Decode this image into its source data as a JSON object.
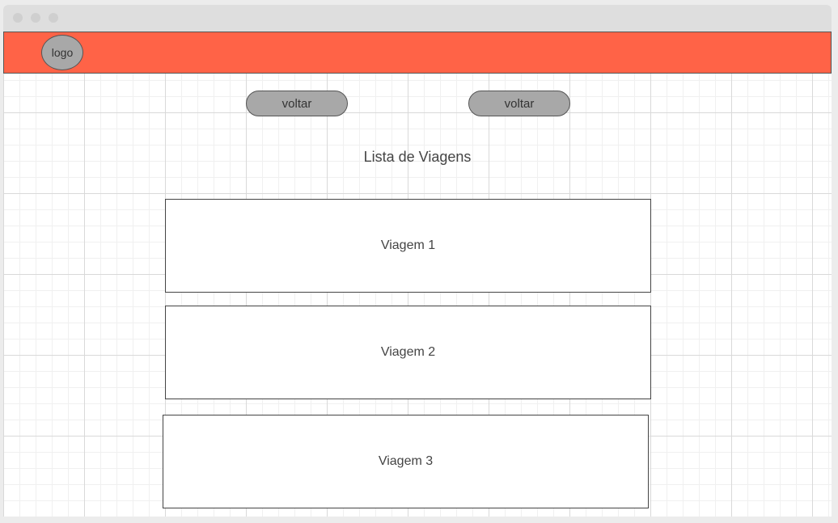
{
  "header": {
    "logo_label": "logo",
    "brand_color": "#ff6347"
  },
  "toolbar": {
    "back_left_label": "voltar",
    "back_right_label": "voltar"
  },
  "main": {
    "title": "Lista de Viagens",
    "trips": [
      {
        "label": "Viagem 1"
      },
      {
        "label": "Viagem 2"
      },
      {
        "label": "Viagem 3"
      }
    ]
  }
}
